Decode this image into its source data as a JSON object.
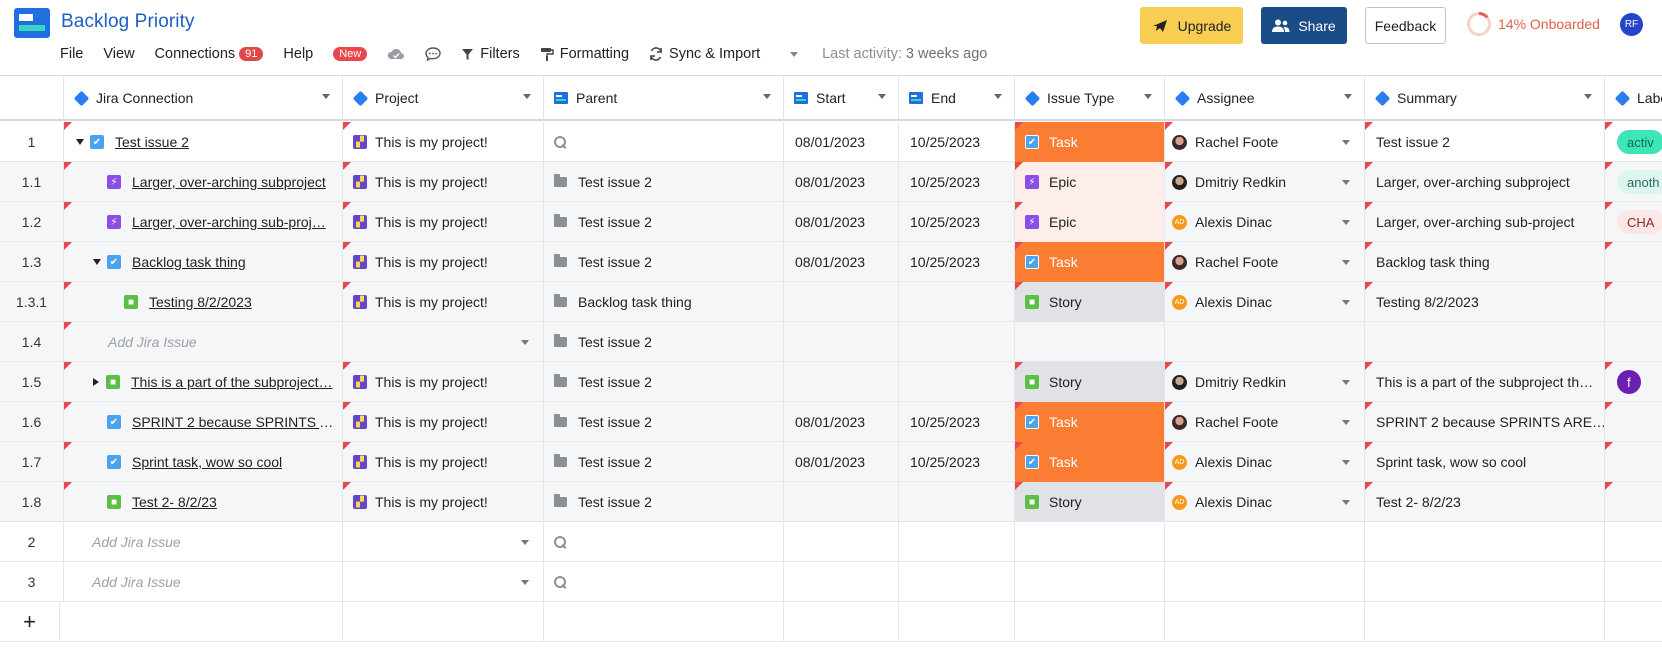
{
  "app": {
    "title": "Backlog Priority"
  },
  "menu": {
    "file": "File",
    "view": "View",
    "connections": "Connections",
    "connections_count": "91",
    "help": "Help",
    "new_badge": "New",
    "filters": "Filters",
    "formatting": "Formatting",
    "sync": "Sync & Import",
    "last_activity_label": "Last activity:",
    "last_activity_value": "3 weeks ago"
  },
  "actions": {
    "upgrade": "Upgrade",
    "share": "Share",
    "feedback": "Feedback",
    "onboarded": "14% Onboarded",
    "onboarded_fraction": 0.14,
    "avatar_initials": "RF"
  },
  "columns": {
    "jira": "Jira Connection",
    "project": "Project",
    "parent": "Parent",
    "start": "Start",
    "end": "End",
    "issue_type": "Issue Type",
    "assignee": "Assignee",
    "summary": "Summary",
    "labels": "Labe"
  },
  "rows": [
    {
      "num": "1",
      "name": "Test issue 2",
      "type_icon": "task",
      "expander": "down",
      "project": "This is my project!",
      "parent": "",
      "parent_icon": "search",
      "start": "08/01/2023",
      "end": "10/25/2023",
      "issue_type": "Task",
      "assignee": "Rachel Foote",
      "assignee_av": "rachel",
      "summary": "Test issue 2",
      "label": "activ",
      "label_bg": "#3ee5b6",
      "label_fg": "#0e6a52"
    },
    {
      "num": "1.1",
      "name": "Larger, over-arching subproject",
      "type_icon": "epic",
      "expander": "",
      "project": "This is my project!",
      "parent": "Test issue 2",
      "parent_icon": "folder",
      "start": "08/01/2023",
      "end": "10/25/2023",
      "issue_type": "Epic",
      "assignee": "Dmitriy Redkin",
      "assignee_av": "dmitriy",
      "summary": "Larger, over-arching subproject",
      "label": "anoth",
      "label_bg": "#dcf6ef",
      "label_fg": "#2a6a5b"
    },
    {
      "num": "1.2",
      "name": "Larger, over-arching sub-proj…",
      "type_icon": "epic",
      "expander": "",
      "project": "This is my project!",
      "parent": "Test issue 2",
      "parent_icon": "folder",
      "start": "08/01/2023",
      "end": "10/25/2023",
      "issue_type": "Epic",
      "assignee": "Alexis Dinac",
      "assignee_av": "alexis",
      "summary": "Larger, over-arching sub-project",
      "label": "CHA",
      "label_bg": "#fde6e6",
      "label_fg": "#8a2d2d"
    },
    {
      "num": "1.3",
      "name": "Backlog task thing",
      "type_icon": "task",
      "expander": "down",
      "project": "This is my project!",
      "parent": "Test issue 2",
      "parent_icon": "folder",
      "start": "08/01/2023",
      "end": "10/25/2023",
      "issue_type": "Task",
      "assignee": "Rachel Foote",
      "assignee_av": "rachel",
      "summary": "Backlog task thing",
      "label": "",
      "label_bg": "",
      "label_fg": ""
    },
    {
      "num": "1.3.1",
      "name": "Testing 8/2/2023",
      "type_icon": "story",
      "expander": "",
      "project": "This is my project!",
      "parent": "Backlog task thing",
      "parent_icon": "folder",
      "start": "",
      "end": "",
      "issue_type": "Story",
      "assignee": "Alexis Dinac",
      "assignee_av": "alexis",
      "summary": "Testing 8/2/2023",
      "label": "",
      "label_bg": "",
      "label_fg": ""
    },
    {
      "num": "1.4",
      "name": "Add Jira Issue",
      "type_icon": "",
      "expander": "",
      "project": "",
      "parent": "Test issue 2",
      "parent_icon": "folder",
      "start": "",
      "end": "",
      "issue_type": "",
      "assignee": "",
      "assignee_av": "",
      "summary": "",
      "label": "",
      "label_bg": "",
      "label_fg": ""
    },
    {
      "num": "1.5",
      "name": "This is a part of the subproject…",
      "type_icon": "story",
      "expander": "right",
      "project": "This is my project!",
      "parent": "Test issue 2",
      "parent_icon": "folder",
      "start": "",
      "end": "",
      "issue_type": "Story",
      "assignee": "Dmitriy Redkin",
      "assignee_av": "dmitriy",
      "summary": "This is a part of the subproject th…",
      "label": "f",
      "label_bg": "#6a1fb0",
      "label_fg": "#ffffff"
    },
    {
      "num": "1.6",
      "name": "SPRINT 2 because SPRINTS A…",
      "type_icon": "task",
      "expander": "",
      "project": "This is my project!",
      "parent": "Test issue 2",
      "parent_icon": "folder",
      "start": "08/01/2023",
      "end": "10/25/2023",
      "issue_type": "Task",
      "assignee": "Rachel Foote",
      "assignee_av": "rachel",
      "summary": "SPRINT 2 because SPRINTS ARE…",
      "label": "",
      "label_bg": "",
      "label_fg": ""
    },
    {
      "num": "1.7",
      "name": "Sprint task, wow so cool",
      "type_icon": "task",
      "expander": "",
      "project": "This is my project!",
      "parent": "Test issue 2",
      "parent_icon": "folder",
      "start": "08/01/2023",
      "end": "10/25/2023",
      "issue_type": "Task",
      "assignee": "Alexis Dinac",
      "assignee_av": "alexis",
      "summary": "Sprint task, wow so cool",
      "label": "",
      "label_bg": "",
      "label_fg": ""
    },
    {
      "num": "1.8",
      "name": "Test 2- 8/2/23",
      "type_icon": "story",
      "expander": "",
      "project": "This is my project!",
      "parent": "Test issue 2",
      "parent_icon": "folder",
      "start": "",
      "end": "",
      "issue_type": "Story",
      "assignee": "Alexis Dinac",
      "assignee_av": "alexis",
      "summary": "Test 2- 8/2/23",
      "label": "",
      "label_bg": "",
      "label_fg": ""
    },
    {
      "num": "2",
      "name": "Add Jira Issue",
      "type_icon": "",
      "expander": "",
      "project": "",
      "parent": "",
      "parent_icon": "search",
      "start": "",
      "end": "",
      "issue_type": "",
      "assignee": "",
      "assignee_av": "",
      "summary": "",
      "label": "",
      "label_bg": "",
      "label_fg": ""
    },
    {
      "num": "3",
      "name": "Add Jira Issue",
      "type_icon": "",
      "expander": "",
      "project": "",
      "parent": "",
      "parent_icon": "search",
      "start": "",
      "end": "",
      "issue_type": "",
      "assignee": "",
      "assignee_av": "",
      "summary": "",
      "label": "",
      "label_bg": "",
      "label_fg": ""
    }
  ],
  "add_row_icon": "+",
  "colors": {
    "task": "#fb7d33",
    "epic": "#fdeeea",
    "story": "#e0e2e6",
    "brand": "#1d5fc6",
    "share": "#1a4c86",
    "upgrade": "#f7cd52"
  }
}
